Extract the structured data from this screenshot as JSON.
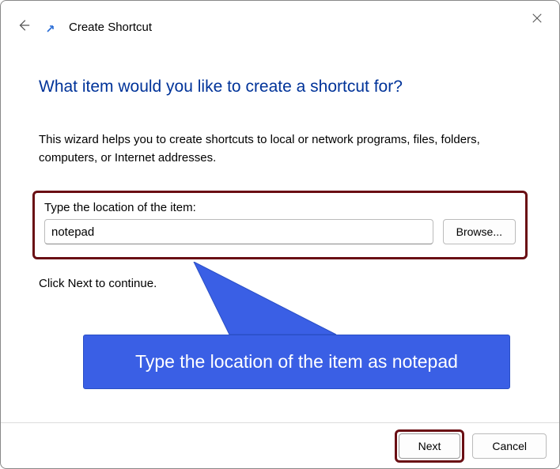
{
  "header": {
    "title": "Create Shortcut"
  },
  "main": {
    "heading": "What item would you like to create a shortcut for?",
    "description": "This wizard helps you to create shortcuts to local or network programs, files, folders, computers, or Internet addresses.",
    "location_label": "Type the location of the item:",
    "location_value": "notepad",
    "browse_label": "Browse...",
    "continue_text": "Click Next to continue."
  },
  "callout": {
    "text": "Type the location of the item as notepad",
    "color": "#3a5fe5"
  },
  "footer": {
    "next_label": "Next",
    "cancel_label": "Cancel"
  }
}
